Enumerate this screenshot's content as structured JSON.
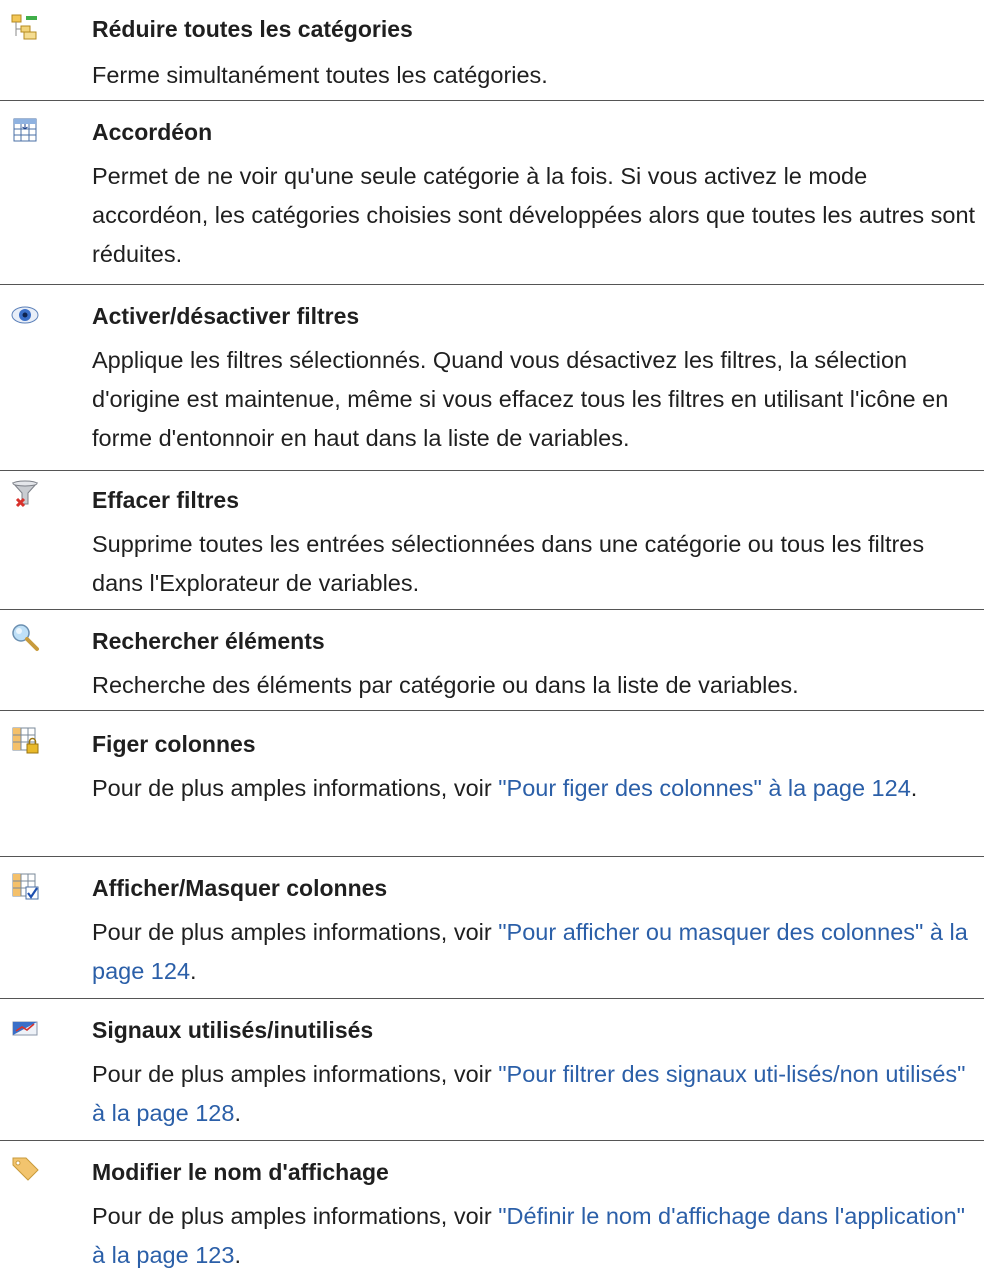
{
  "items": [
    {
      "icon": "collapse-tree-icon",
      "title": "Réduire toutes les catégories",
      "desc": "Ferme simultanément toutes les catégories."
    },
    {
      "icon": "accordion-table-icon",
      "title": "Accordéon",
      "desc": "Permet de ne voir qu'une seule catégorie à la fois. Si vous activez le mode accordéon, les catégories choisies sont développées alors que toutes les autres sont réduites."
    },
    {
      "icon": "eye-icon",
      "title": "Activer/désactiver filtres",
      "desc": "Applique les filtres sélectionnés. Quand vous désactivez les filtres, la sélection d'origine est maintenue, même si vous effacez tous les filtres en utilisant l'icône en forme d'entonnoir en haut dans la liste de variables."
    },
    {
      "icon": "funnel-clear-icon",
      "title": "Effacer filtres",
      "desc": "Supprime toutes les entrées sélectionnées dans une catégorie ou tous les filtres dans l'Explorateur de variables."
    },
    {
      "icon": "magnifier-icon",
      "title": "Rechercher éléments",
      "desc": "Recherche des éléments par catégorie ou dans la liste de variables."
    },
    {
      "icon": "freeze-columns-lock-icon",
      "title": "Figer colonnes",
      "desc_prefix": "Pour de plus amples informations, voir ",
      "link": "\"Pour figer des colonnes\" à la page 124",
      "desc_suffix": "."
    },
    {
      "icon": "show-hide-columns-check-icon",
      "title": "Afficher/Masquer colonnes",
      "desc_prefix": "Pour de plus amples informations, voir ",
      "link": "\"Pour afficher ou masquer des colonnes\" à la page 124",
      "desc_suffix": "."
    },
    {
      "icon": "signals-used-unused-icon",
      "title": "Signaux utilisés/inutilisés",
      "desc_prefix": "Pour de plus amples informations, voir ",
      "link": "\"Pour filtrer des signaux uti-lisés/non utilisés\" à la page 128",
      "desc_suffix": "."
    },
    {
      "icon": "tag-label-icon",
      "title": "Modifier le nom d'affichage",
      "desc_prefix": "Pour de plus amples informations, voir ",
      "link": "\"Définir le nom d'affichage dans l'application\" à la page 123",
      "desc_suffix": "."
    }
  ]
}
